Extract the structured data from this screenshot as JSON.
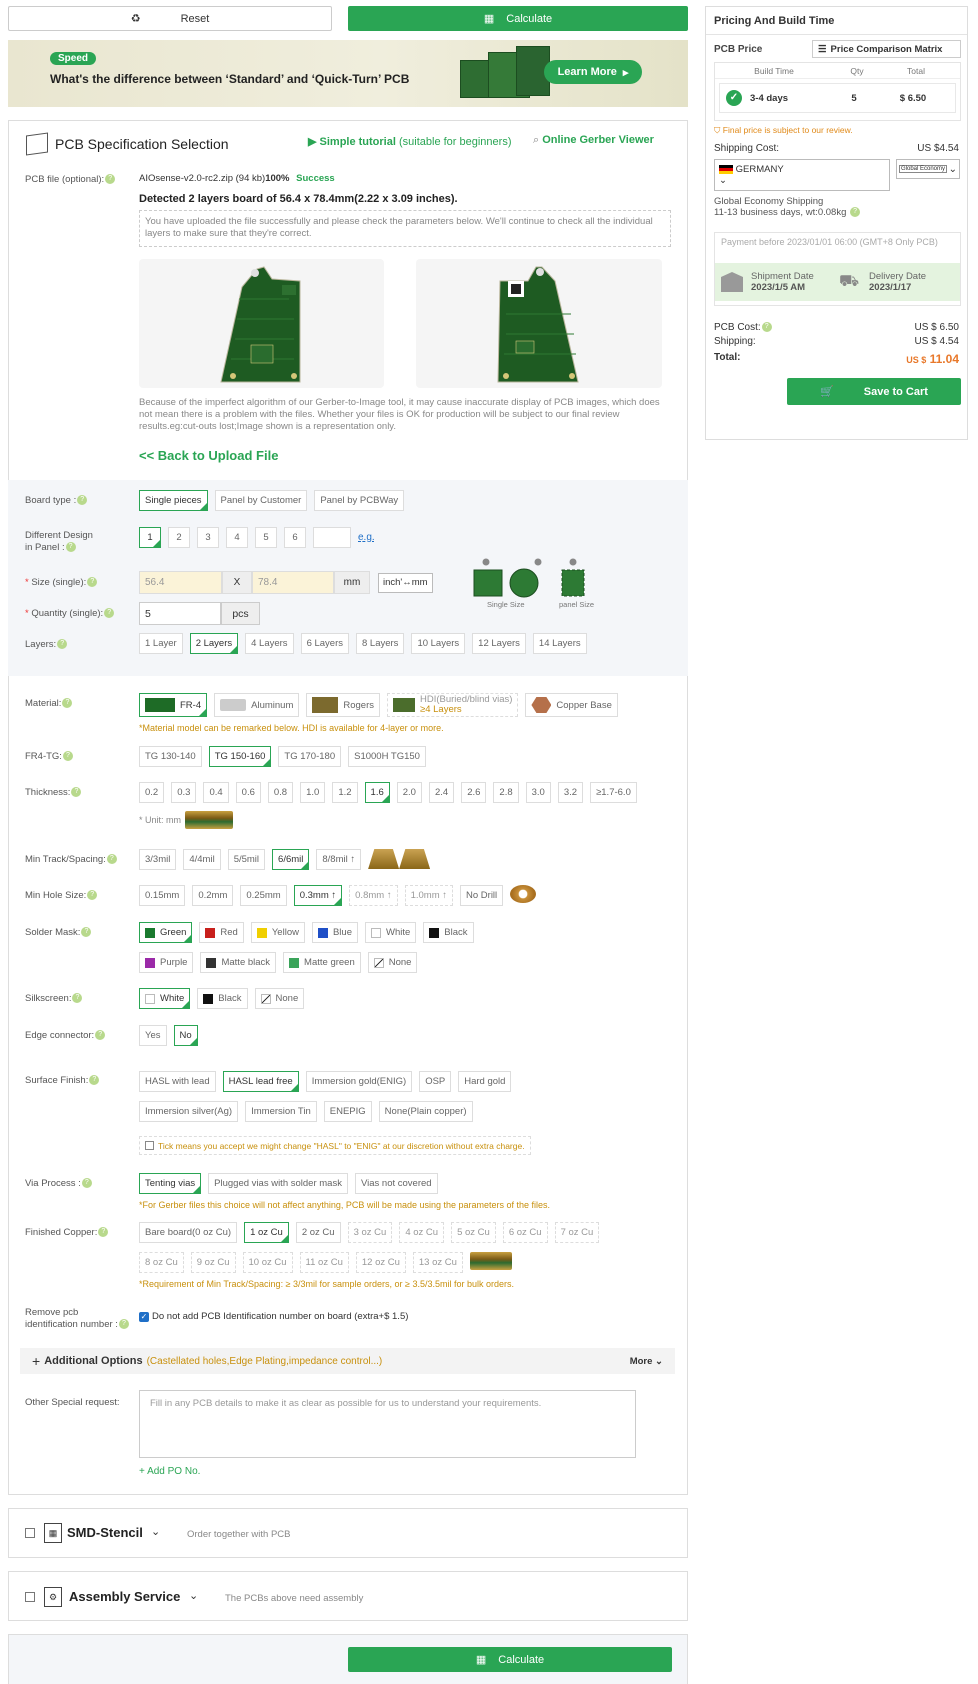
{
  "toolbar": {
    "reset_label": "Reset",
    "calculate_label": "Calculate"
  },
  "banner": {
    "badge": "Speed",
    "headline": "What's the difference between ‘Standard’ and ‘Quick-Turn’ PCB",
    "cta": "Learn More"
  },
  "spec": {
    "title": "PCB Specification Selection",
    "tutorial": "Simple tutorial",
    "tutorial_suffix": "(suitable for beginners)",
    "gerber_viewer": "Online Gerber Viewer",
    "pcb_file_label": "PCB file (optional):",
    "file_name": "AIOsense-v2.0-rc2.zip (94 kb)",
    "file_percent": "100%",
    "file_status": "Success",
    "detected": "Detected 2 layers board of 56.4 x 78.4mm(2.22 x 3.09 inches).",
    "upload_note": "You have uploaded the file successfully and please check the parameters below. We'll continue to check all the individual layers to make sure that they're correct.",
    "disclaimer": "Because of the imperfect algorithm of our Gerber-to-Image tool, it may cause inaccurate display of PCB images, which does not mean there is a problem with the files. Whether your files is OK for production will be subject to our final review results.eg:cut-outs lost;Image shown is a representation only.",
    "back_link": "<< Back to Upload File"
  },
  "form": {
    "board_type": {
      "label": "Board type :",
      "options": [
        "Single pieces",
        "Panel by Customer",
        "Panel by PCBWay"
      ]
    },
    "design": {
      "label1": "Different Design",
      "label2": "in Panel :",
      "options": [
        "1",
        "2",
        "3",
        "4",
        "5",
        "6"
      ],
      "eg": "e.g."
    },
    "size": {
      "label": "Size (single):",
      "w": "56.4",
      "x": "X",
      "h": "78.4",
      "unit": "mm",
      "toggle": "inch'↔mm",
      "single_caption": "Single Size",
      "panel_caption": "panel Size"
    },
    "qty": {
      "label": "Quantity (single):",
      "value": "5",
      "unit": "pcs"
    },
    "layers": {
      "label": "Layers:",
      "options": [
        "1 Layer",
        "2 Layers",
        "4 Layers",
        "6 Layers",
        "8 Layers",
        "10 Layers",
        "12 Layers",
        "14 Layers"
      ]
    },
    "material": {
      "label": "Material:",
      "options": [
        "FR-4",
        "Aluminum",
        "Rogers",
        "HDI(Buried/blind vias)",
        "Copper Base"
      ],
      "hdi_sub": "≥4 Layers",
      "note": "*Material model can be remarked below. HDI is available for 4-layer or more."
    },
    "tg": {
      "label": "FR4-TG:",
      "options": [
        "TG 130-140",
        "TG 150-160",
        "TG 170-180",
        "S1000H TG150"
      ]
    },
    "thickness": {
      "label": "Thickness:",
      "options": [
        "0.2",
        "0.3",
        "0.4",
        "0.6",
        "0.8",
        "1.0",
        "1.2",
        "1.6",
        "2.0",
        "2.4",
        "2.6",
        "2.8",
        "3.0",
        "3.2"
      ],
      "extra": "≥1.7-6.0",
      "unit_note": "* Unit: mm"
    },
    "track": {
      "label": "Min Track/Spacing:",
      "options": [
        "3/3mil",
        "4/4mil",
        "5/5mil",
        "6/6mil",
        "8/8mil ↑"
      ]
    },
    "hole": {
      "label": "Min Hole Size:",
      "options": [
        "0.15mm",
        "0.2mm",
        "0.25mm",
        "0.3mm ↑",
        "0.8mm ↑",
        "1.0mm ↑",
        "No Drill"
      ]
    },
    "mask": {
      "label": "Solder Mask:",
      "row1": [
        "Green",
        "Red",
        "Yellow",
        "Blue",
        "White",
        "Black"
      ],
      "row2": [
        "Purple",
        "Matte black",
        "Matte green",
        "None"
      ],
      "colors": {
        "Green": "#1a7a2e",
        "Red": "#c8201c",
        "Yellow": "#f0cf00",
        "Blue": "#1f4fc7",
        "White": "#ffffff",
        "Black": "#111111",
        "Purple": "#9b2aa8",
        "Matte black": "#333333",
        "Matte green": "#3aa45a"
      }
    },
    "silk": {
      "label": "Silkscreen:",
      "options": [
        "White",
        "Black",
        "None"
      ]
    },
    "edge": {
      "label": "Edge connector:",
      "options": [
        "Yes",
        "No"
      ]
    },
    "finish": {
      "label": "Surface Finish:",
      "row1": [
        "HASL with lead",
        "HASL lead free",
        "Immersion gold(ENIG)",
        "OSP",
        "Hard gold"
      ],
      "row2": [
        "Immersion silver(Ag)",
        "Immersion Tin",
        "ENEPIG",
        "None(Plain copper)"
      ],
      "tick_note": "Tick means you accept we might change \"HASL\" to \"ENIG\" at our discretion without extra charge."
    },
    "via": {
      "label": "Via Process :",
      "options": [
        "Tenting vias",
        "Plugged vias with solder mask",
        "Vias not covered"
      ],
      "note": "*For Gerber files this choice will not affect anything, PCB will be made using the parameters of the files."
    },
    "copper": {
      "label": "Finished Copper:",
      "row1": [
        "Bare board(0 oz Cu)",
        "1 oz Cu",
        "2 oz Cu",
        "3 oz Cu",
        "4 oz Cu",
        "5 oz Cu",
        "6 oz Cu",
        "7 oz Cu"
      ],
      "row2": [
        "8 oz Cu",
        "9 oz Cu",
        "10 oz Cu",
        "11 oz Cu",
        "12 oz Cu",
        "13 oz Cu"
      ],
      "note": "*Requirement of Min Track/Spacing: ≥ 3/3mil for sample orders, or ≥ 3.5/3.5mil for bulk orders."
    },
    "remove_id": {
      "label1": "Remove pcb",
      "label2": "identification number :",
      "check_label": "Do not add PCB Identification number on board (extra+$ 1.5)"
    },
    "additional": {
      "title": "Additional Options",
      "sub": "(Castellated holes,Edge Plating,impedance control...)",
      "more": "More"
    },
    "special": {
      "label": "Other Special request:",
      "placeholder": "Fill in any PCB details to make it as clear as possible for us to understand your requirements.",
      "add_po": "+ Add PO No."
    }
  },
  "stencil": {
    "title": "SMD-Stencil",
    "sub": "Order together with PCB"
  },
  "assembly": {
    "title": "Assembly Service",
    "sub": "The PCBs above need assembly"
  },
  "pricing": {
    "title": "Pricing And Build Time",
    "pcb_price": "PCB Price",
    "matrix": "Price Comparison Matrix",
    "headers": [
      "Build Time",
      "Qty",
      "Total"
    ],
    "row": {
      "build": "3-4 days",
      "qty": "5",
      "total": "$ 6.50"
    },
    "final_note": "Final price is subject to our review.",
    "shipping_label": "Shipping Cost:",
    "shipping_value": "US $4.54",
    "country": "GERMANY",
    "method": "Global Economy",
    "method_name": "Global Economy Shipping",
    "method_info": "11-13 business days, wt:0.08kg",
    "payment_note": "Payment before 2023/01/01 06:00 (GMT+8 Only PCB)",
    "ship_date_label": "Shipment Date",
    "ship_date": "2023/1/5 AM",
    "delivery_label": "Delivery Date",
    "delivery_date": "2023/1/17",
    "pcb_cost_label": "PCB Cost:",
    "pcb_cost": "US $ 6.50",
    "shipping2_label": "Shipping:",
    "shipping2": "US $ 4.54",
    "total_label": "Total:",
    "total_prefix": "US $",
    "total": "11.04",
    "save": "Save to Cart"
  }
}
